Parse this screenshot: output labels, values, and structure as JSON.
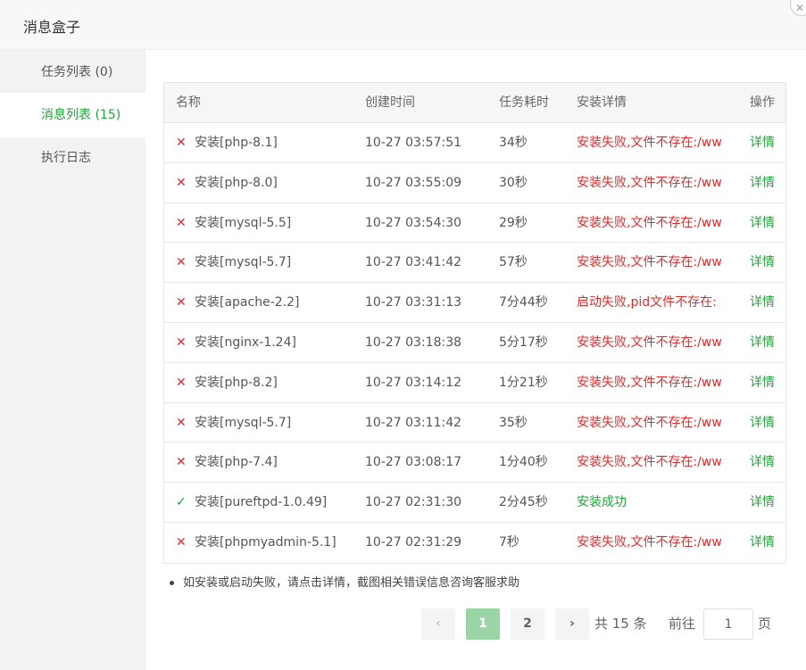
{
  "dialog": {
    "title": "消息盒子",
    "close_symbol": "✕"
  },
  "sidebar": {
    "items": [
      {
        "label": "任务列表 (0)",
        "active": false
      },
      {
        "label": "消息列表 (15)",
        "active": true
      },
      {
        "label": "执行日志",
        "active": false
      }
    ]
  },
  "table": {
    "headers": {
      "name": "名称",
      "time": "创建时间",
      "duration": "任务耗时",
      "detail": "安装详情",
      "op": "操作"
    },
    "rows": [
      {
        "status": "fail",
        "name": "安装[php-8.1]",
        "time": "10-27 03:57:51",
        "duration": "34秒",
        "detail": "安装失败,文件不存在:/ww",
        "op": "详情"
      },
      {
        "status": "fail",
        "name": "安装[php-8.0]",
        "time": "10-27 03:55:09",
        "duration": "30秒",
        "detail": "安装失败,文件不存在:/ww",
        "op": "详情"
      },
      {
        "status": "fail",
        "name": "安装[mysql-5.5]",
        "time": "10-27 03:54:30",
        "duration": "29秒",
        "detail": "安装失败,文件不存在:/ww",
        "op": "详情"
      },
      {
        "status": "fail",
        "name": "安装[mysql-5.7]",
        "time": "10-27 03:41:42",
        "duration": "57秒",
        "detail": "安装失败,文件不存在:/ww",
        "op": "详情"
      },
      {
        "status": "fail",
        "name": "安装[apache-2.2]",
        "time": "10-27 03:31:13",
        "duration": "7分44秒",
        "detail": "启动失败,pid文件不存在:",
        "op": "详情"
      },
      {
        "status": "fail",
        "name": "安装[nginx-1.24]",
        "time": "10-27 03:18:38",
        "duration": "5分17秒",
        "detail": "安装失败,文件不存在:/ww",
        "op": "详情"
      },
      {
        "status": "fail",
        "name": "安装[php-8.2]",
        "time": "10-27 03:14:12",
        "duration": "1分21秒",
        "detail": "安装失败,文件不存在:/ww",
        "op": "详情"
      },
      {
        "status": "fail",
        "name": "安装[mysql-5.7]",
        "time": "10-27 03:11:42",
        "duration": "35秒",
        "detail": "安装失败,文件不存在:/ww",
        "op": "详情"
      },
      {
        "status": "fail",
        "name": "安装[php-7.4]",
        "time": "10-27 03:08:17",
        "duration": "1分40秒",
        "detail": "安装失败,文件不存在:/ww",
        "op": "详情"
      },
      {
        "status": "ok",
        "name": "安装[pureftpd-1.0.49]",
        "time": "10-27 02:31:30",
        "duration": "2分45秒",
        "detail": "安装成功",
        "op": "详情"
      },
      {
        "status": "fail",
        "name": "安装[phpmyadmin-5.1]",
        "time": "10-27 02:31:29",
        "duration": "7秒",
        "detail": "安装失败,文件不存在:/ww",
        "op": "详情"
      }
    ]
  },
  "tip": "如安装或启动失败，请点击详情，截图相关错误信息咨询客服求助",
  "pagination": {
    "prev": "‹",
    "next": "›",
    "pages": [
      "1",
      "2"
    ],
    "current": "1",
    "total_text": "共 15 条",
    "goto_label": "前往",
    "goto_value": "1",
    "page_suffix": "页"
  },
  "colors": {
    "accent": "#20a53a",
    "error": "#e02b2b"
  },
  "icons": {
    "fail": "✕",
    "ok": "✓"
  }
}
